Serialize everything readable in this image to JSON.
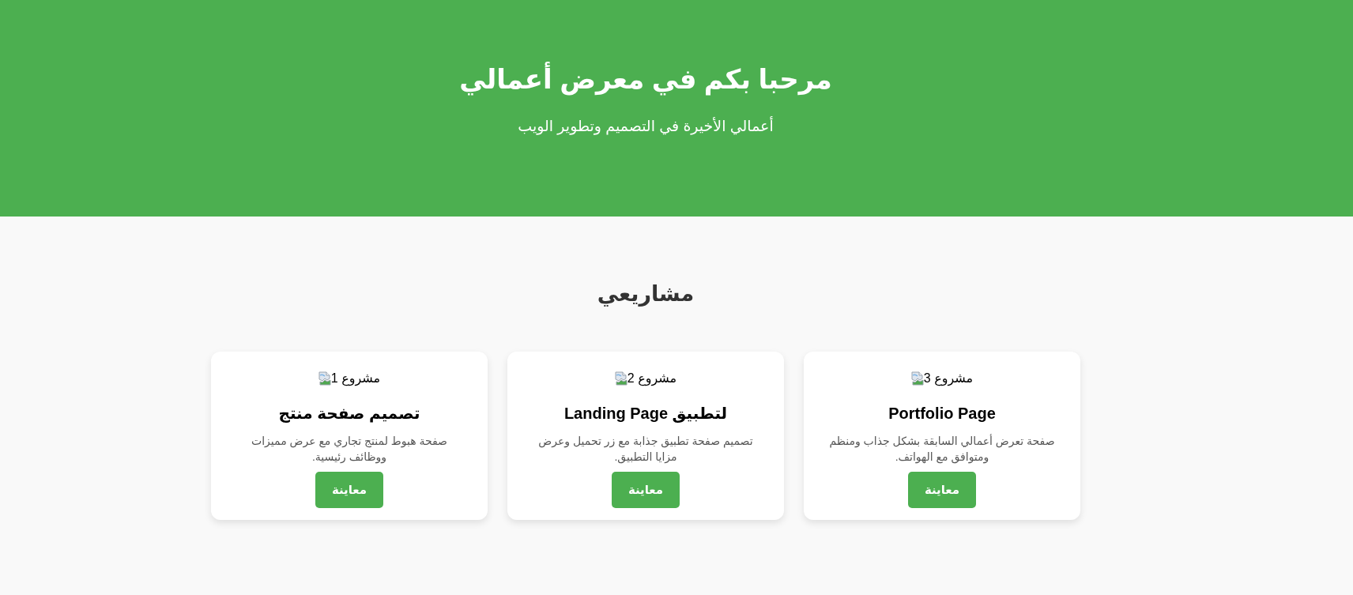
{
  "header": {
    "title": "مرحبا بكم في معرض أعمالي",
    "subtitle": "أعمالي الأخيرة في التصميم وتطوير الويب"
  },
  "projects": {
    "heading": "مشاريعي",
    "cards": [
      {
        "image_alt": "مشروع 3",
        "title": "Portfolio Page",
        "description": "صفحة تعرض أعمالي السابقة بشكل جذاب ومنظم ومتوافق مع الهواتف.",
        "button": "معاينة"
      },
      {
        "image_alt": "مشروع 2",
        "title": "Landing Page لتطبيق",
        "description": "تصميم صفحة تطبيق جذابة مع زر تحميل وعرض مزايا التطبيق.",
        "button": "معاينة"
      },
      {
        "image_alt": "مشروع 1",
        "title": "تصميم صفحة منتج",
        "description": "صفحة هبوط لمنتج تجاري مع عرض مميزات ووظائف رئيسية.",
        "button": "معاينة"
      }
    ]
  }
}
